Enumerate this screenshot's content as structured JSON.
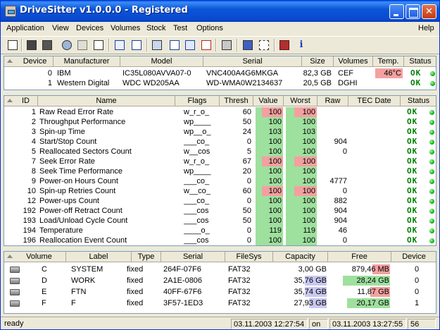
{
  "window": {
    "title": "DriveSitter v1.0.0.0 - Registered"
  },
  "menu": [
    "Application",
    "View",
    "Devices",
    "Volumes",
    "Stock",
    "Test",
    "Options",
    "Help"
  ],
  "toolbar_icons": [
    "copy-icon",
    "save-icon",
    "refresh-icon",
    "print-icon",
    "edit-icon",
    "check-icon",
    "list-icon",
    "drive-icon",
    "grid-icon",
    "table-icon",
    "remove-icon",
    "settings-icon",
    "export-icon",
    "select-icon",
    "book-icon",
    "info-icon"
  ],
  "devices": {
    "headers": [
      "Device",
      "Manufacturer",
      "Model",
      "Serial",
      "Size",
      "Volumes",
      "Temp.",
      "Status"
    ],
    "rows": [
      {
        "device": "0",
        "manufacturer": "IBM",
        "model": "IC35L080AVVA07-0",
        "serial": "VNC400A4G6MKGA",
        "size": "82,3 GB",
        "volumes": "CEF",
        "temp": "46°C",
        "status": "OK"
      },
      {
        "device": "1",
        "manufacturer": "Western Digital",
        "model": "WDC WD205AA",
        "serial": "WD-WMA0W2134637",
        "size": "20,5 GB",
        "volumes": "DGHI",
        "temp": "",
        "status": "OK"
      }
    ]
  },
  "smart": {
    "headers": [
      "ID",
      "Name",
      "Flags",
      "Thresh",
      "Value",
      "Worst",
      "Raw",
      "TEC Date",
      "Status"
    ],
    "rows": [
      {
        "id": "1",
        "name": "Raw Read Error Rate",
        "flags": "w_r_o_",
        "thresh": "60",
        "value": "100",
        "worst": "100",
        "raw": "",
        "status": "OK"
      },
      {
        "id": "2",
        "name": "Throughput Performance",
        "flags": "wp____",
        "thresh": "50",
        "value": "100",
        "worst": "100",
        "raw": "",
        "status": "OK"
      },
      {
        "id": "3",
        "name": "Spin-up Time",
        "flags": "wp__o_",
        "thresh": "24",
        "value": "103",
        "worst": "103",
        "raw": "",
        "status": "OK"
      },
      {
        "id": "4",
        "name": "Start/Stop Count",
        "flags": "___co_",
        "thresh": "0",
        "value": "100",
        "worst": "100",
        "raw": "904",
        "status": "OK"
      },
      {
        "id": "5",
        "name": "Reallocated Sectors Count",
        "flags": "w__cos",
        "thresh": "5",
        "value": "100",
        "worst": "100",
        "raw": "0",
        "status": "OK"
      },
      {
        "id": "7",
        "name": "Seek Error Rate",
        "flags": "w_r_o_",
        "thresh": "67",
        "value": "100",
        "worst": "100",
        "raw": "",
        "status": "OK"
      },
      {
        "id": "8",
        "name": "Seek Time Performance",
        "flags": "wp____",
        "thresh": "20",
        "value": "100",
        "worst": "100",
        "raw": "",
        "status": "OK"
      },
      {
        "id": "9",
        "name": "Power-on Hours Count",
        "flags": "___co_",
        "thresh": "0",
        "value": "100",
        "worst": "100",
        "raw": "4777",
        "status": "OK"
      },
      {
        "id": "10",
        "name": "Spin-up Retries Count",
        "flags": "w__co_",
        "thresh": "60",
        "value": "100",
        "worst": "100",
        "raw": "0",
        "status": "OK"
      },
      {
        "id": "12",
        "name": "Power-ups Count",
        "flags": "___co_",
        "thresh": "0",
        "value": "100",
        "worst": "100",
        "raw": "882",
        "status": "OK"
      },
      {
        "id": "192",
        "name": "Power-off Retract Count",
        "flags": "___cos",
        "thresh": "50",
        "value": "100",
        "worst": "100",
        "raw": "904",
        "status": "OK"
      },
      {
        "id": "193",
        "name": "Load/Unload Cycle Count",
        "flags": "___cos",
        "thresh": "50",
        "value": "100",
        "worst": "100",
        "raw": "904",
        "status": "OK"
      },
      {
        "id": "194",
        "name": "Temperature",
        "flags": "____o_",
        "thresh": "0",
        "value": "119",
        "worst": "119",
        "raw": "46",
        "status": "OK"
      },
      {
        "id": "196",
        "name": "Reallocation Event Count",
        "flags": "___cos",
        "thresh": "0",
        "value": "100",
        "worst": "100",
        "raw": "0",
        "status": "OK"
      }
    ]
  },
  "volumes": {
    "headers": [
      "Volume",
      "Label",
      "Type",
      "Serial",
      "FileSys",
      "Capacity",
      "Free",
      "Device"
    ],
    "rows": [
      {
        "volume": "C",
        "label": "SYSTEM",
        "type": "fixed",
        "serial": "264F-07F6",
        "filesys": "FAT32",
        "capacity": "3,00 GB",
        "free": "879,46 MB",
        "device": "0",
        "capacity_fill": 0.0,
        "free_fill": 0.29,
        "free_color": "#f4a0a0"
      },
      {
        "volume": "D",
        "label": "WORK",
        "type": "fixed",
        "serial": "2A1E-0806",
        "filesys": "FAT32",
        "capacity": "35,76 GB",
        "free": "28,24 GB",
        "device": "0",
        "capacity_fill": 0.43,
        "free_fill": 0.79,
        "free_color": "#9ee09e"
      },
      {
        "volume": "E",
        "label": "FTN",
        "type": "fixed",
        "serial": "40FF-67F6",
        "filesys": "FAT32",
        "capacity": "35,74 GB",
        "free": "11,87 GB",
        "device": "0",
        "capacity_fill": 0.43,
        "free_fill": 0.33,
        "free_color": "#f4a0a0"
      },
      {
        "volume": "F",
        "label": "F",
        "type": "fixed",
        "serial": "3F57-1ED3",
        "filesys": "FAT32",
        "capacity": "27,93 GB",
        "free": "20,17 GB",
        "device": "1",
        "capacity_fill": 0.34,
        "free_fill": 0.72,
        "free_color": "#9ee09e"
      }
    ]
  },
  "statusbar": {
    "state": "ready",
    "time1": "03.11.2003 12:27:54",
    "on_label": "on",
    "time2": "03.11.2003 13:27:55",
    "count": "56"
  },
  "colors": {
    "red_bar": "#f4a0a0",
    "green_bar": "#9ee09e",
    "blue_bar": "#c8c8f0",
    "ok": "#007f00"
  }
}
